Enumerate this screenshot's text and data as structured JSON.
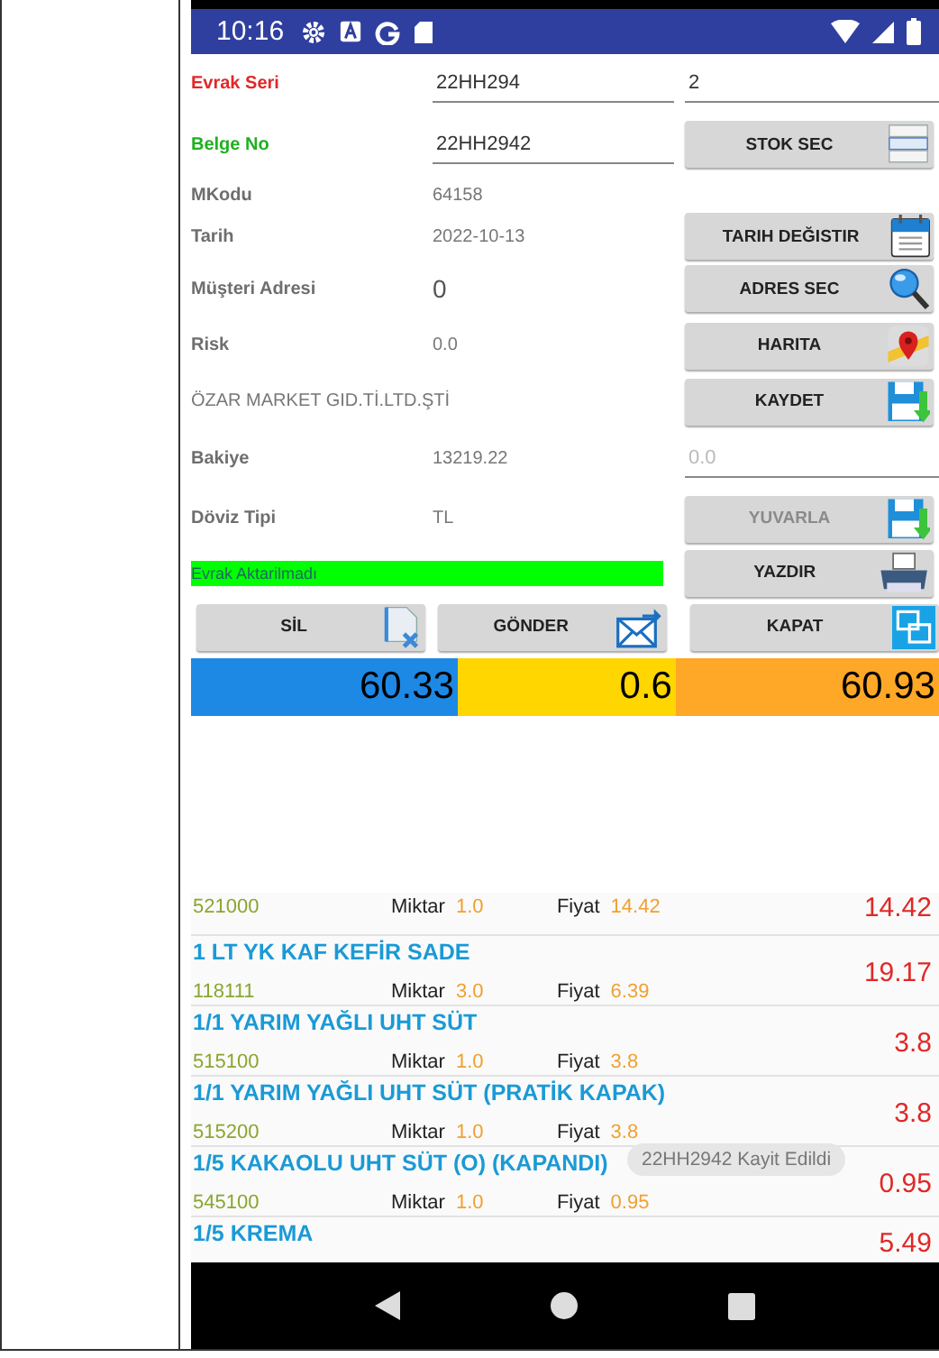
{
  "status_bar": {
    "time": "10:16"
  },
  "form": {
    "rows": [
      {
        "kind": "input",
        "label": "Evrak Seri",
        "color": "#e02828",
        "value": "22HH294",
        "side": {
          "kind": "input",
          "value": "2"
        }
      },
      {
        "kind": "input",
        "label": "Belge No",
        "color": "#20b020",
        "value": "22HH2942",
        "side": {
          "kind": "button",
          "label": "STOK SEC",
          "disabled": false
        }
      },
      {
        "kind": "text",
        "label": "MKodu",
        "color": "#6e6e6e",
        "value": "64158"
      },
      {
        "kind": "text",
        "label": "Tarih",
        "color": "#6e6e6e",
        "value": "2022-10-13",
        "side": {
          "kind": "button",
          "label": "TARIH DEĞISTIR",
          "disabled": false
        }
      },
      {
        "kind": "text",
        "label": "Müşteri Adresi",
        "color": "#6e6e6e",
        "value": "0",
        "side": {
          "kind": "button",
          "label": "ADRES SEC",
          "disabled": false
        }
      },
      {
        "kind": "text",
        "label": "Risk",
        "color": "#6e6e6e",
        "value": "0.0",
        "side": {
          "kind": "button",
          "label": "HARITA",
          "disabled": false
        }
      },
      {
        "kind": "wide",
        "value": "ÖZAR MARKET GID.Tİ.LTD.ŞTİ",
        "side": {
          "kind": "button",
          "label": "KAYDET",
          "disabled": false
        }
      },
      {
        "kind": "text",
        "label": "Bakiye",
        "color": "#6e6e6e",
        "value": "13219.22",
        "side": {
          "kind": "input",
          "placeholder": "0.0"
        }
      },
      {
        "kind": "text",
        "label": "Döviz Tipi",
        "color": "#6e6e6e",
        "value": "TL",
        "side": {
          "kind": "button",
          "label": "YUVARLA",
          "disabled": true
        }
      },
      {
        "kind": "status",
        "value": "Evrak Aktarilmadı",
        "side": {
          "kind": "button",
          "label": "YAZDIR",
          "disabled": false
        }
      }
    ]
  },
  "actions": [
    {
      "label": "SİL"
    },
    {
      "label": "GÖNDER"
    },
    {
      "label": "KAPAT"
    }
  ],
  "totals": [
    {
      "value": "60.33",
      "color": "#1e88e5"
    },
    {
      "value": "0.6",
      "color": "#ffd600"
    },
    {
      "value": "60.93",
      "color": "#ffa726"
    }
  ],
  "items": [
    {
      "code": "521000",
      "qty_label": "Miktar",
      "qty": "1.0",
      "price_label": "Fiyat",
      "price": "14.42",
      "total": "14.42"
    },
    {
      "name": "1 LT YK KAF KEFİR SADE",
      "code": "118111",
      "qty_label": "Miktar",
      "qty": "3.0",
      "price_label": "Fiyat",
      "price": "6.39",
      "total": "19.17"
    },
    {
      "name": "1/1 YARIM YAĞLI UHT SÜT",
      "code": "515100",
      "qty_label": "Miktar",
      "qty": "1.0",
      "price_label": "Fiyat",
      "price": "3.8",
      "total": "3.8"
    },
    {
      "name": "1/1 YARIM YAĞLI UHT SÜT (PRATİK KAPAK)",
      "code": "515200",
      "qty_label": "Miktar",
      "qty": "1.0",
      "price_label": "Fiyat",
      "price": "3.8",
      "total": "3.8"
    },
    {
      "name": "1/5 KAKAOLU UHT SÜT (O) (KAPANDI)",
      "code": "545100",
      "qty_label": "Miktar",
      "qty": "1.0",
      "price_label": "Fiyat",
      "price": "0.95",
      "total": "0.95"
    },
    {
      "name": "1/5 KREMA",
      "total": "5.49"
    }
  ],
  "toast": "22HH2942 Kayit Edildi"
}
